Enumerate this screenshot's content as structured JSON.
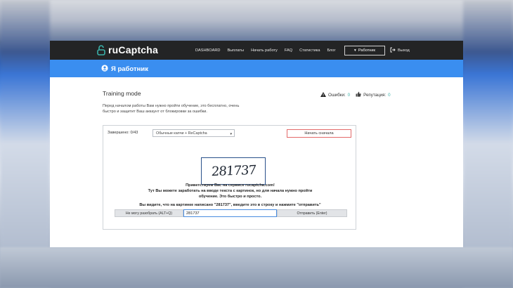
{
  "app": {
    "brand": "ruCaptcha",
    "nav": [
      "DASHBOARD",
      "Выплаты",
      "Начать работу",
      "FAQ",
      "Статистика",
      "Блог"
    ],
    "worker_button": "Работник",
    "logout": "Выход"
  },
  "page": {
    "band_title": "Я работник",
    "title": "Training mode",
    "intro": "Перед началом работы Вам нужно пройти обучение, это бесплатно, очень быстро и защитит Ваш аккаунт от блокировки за ошибки."
  },
  "stats": {
    "errors_label": "Ошибки:",
    "errors_value": "0",
    "reputation_label": "Репутация:",
    "reputation_value": "0"
  },
  "training": {
    "completed": "Завершено: 0/43",
    "mode_select": "Обычные капчи + ReCaptcha",
    "restart_button": "Начать сначала",
    "captcha_text": "281737",
    "welcome_line1": "Приветствуем Вас на сервисе rucaptcha.com!",
    "welcome_line2": "Тут Вы можете заработать на вводе текста с картинок, но для начала нужно пройти",
    "welcome_line3": "обучение. Это быстро и просто.",
    "instruction": "Вы видите, что на картинке написано \"281737\", введите это в строку и нажмите \"отправить\"",
    "cant_button": "Не могу разобрать (ALT+Q)",
    "answer_value": "281737",
    "send_button": "Отправить (Enter)"
  },
  "colors": {
    "topbar": "#232425",
    "accent_blue": "#3a8ef0",
    "teal": "#3ab0a8",
    "restart_border": "#e36a6a"
  }
}
